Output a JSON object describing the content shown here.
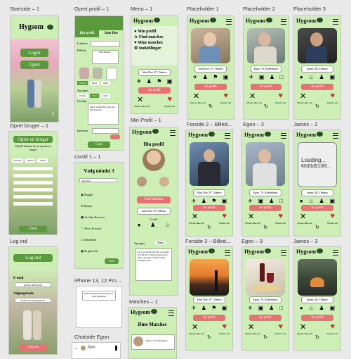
{
  "labels": {
    "startside": "Startside – 1",
    "opret_profil": "Opret profil – 1",
    "menu": "Menu – 1",
    "ph1": "Placeholder 1",
    "ph2": "Placeholder 2",
    "ph3": "Placeholder 3",
    "opret_bruger": "Opret bruger – 1",
    "min_profil": "Min Profil – 1",
    "forside2": "Forside 2 – Billed...",
    "egon2": "Egon – 2",
    "james2": "James – 2",
    "livstil": "Livstil 1 – 1",
    "log_ind": "Log ind",
    "iphone": "iPhone 13, 12 Pro ...",
    "forside3": "Forside 3 – Billed...",
    "egon3": "Egon – 3",
    "james3": "James – 3",
    "matches": "Matches – 1",
    "chatside": "Chatside Egon"
  },
  "brand": "Hygsom",
  "startside": {
    "login": "Login",
    "opret": "Opret"
  },
  "opret_profil": {
    "tab1": "Din profil",
    "tab2": "Jane Doe",
    "lokation": "Lokation",
    "billeder": "Billeder",
    "upload_hint": "Tilføj billeder +",
    "om_mig": "Om mig",
    "om_mig_text": "Indsæt beskrivelse af dig selv. Lidt interesser",
    "jeg_soger": "Jeg søger:",
    "opt1": "Kvinde",
    "opt2": "Mand",
    "opt3": "Andet",
    "interesser": "Interesser",
    "gem": "Gem"
  },
  "menu": {
    "items": [
      "Min profil",
      "Find matches",
      "Mine matches",
      "Indstillinger"
    ],
    "name": "John Doe, 87, Odense",
    "profil_btn": "Se profil",
    "skip": "Nyeste ikke om",
    "yes": "Nyeste om",
    "refresh": "Genlæs"
  },
  "cards": {
    "ph1": {
      "name": "John Doe, 87, Odense"
    },
    "ph2": {
      "name": "Egon, 76, København"
    },
    "ph3": {
      "name": "James, 82, Odense"
    },
    "forside2": {
      "name": "John Doe, 87, Odense"
    },
    "egon2": {
      "name": "Egon, 76, København"
    },
    "james2": {
      "name": "James, 82, Odense",
      "loading": "Loading...",
      "loading_id": "60d3d513f0..."
    },
    "forside3": {
      "name": "John Doe, 87, Odense"
    },
    "egon3": {
      "name": "Egon, 76, København"
    },
    "james3": {
      "name": "James, 82, Odense"
    }
  },
  "opret_bruger": {
    "title": "Opret en bruger",
    "subtitle": "Udfyld felterne for at oprette en bruger",
    "opt1": "Kvinde",
    "opt2": "Mand",
    "opt3": "Andet",
    "gem": "Gem"
  },
  "min_profil": {
    "title": "Din profil",
    "find": "Find Matches",
    "name": "Jane Doe, 67, Odense",
    "livstil": "Livstil",
    "jeg_soger": "Jeg søger:",
    "soger_value": "Mand",
    "about": "Jeg er en kvinde på 67 år, som holder af at gå ture i naturen og læse gode bøger. Jeg søger en mand at dele hverdagen med."
  },
  "livstil": {
    "title": "Vælg mindst 3",
    "search": "Søg efter...",
    "items": [
      "Hygge",
      "Rejser",
      "Se film & serier",
      "Skov & natur",
      "Dansehal",
      "Et glas vin"
    ],
    "gem": "Gem"
  },
  "log_ind": {
    "title": "Log ind",
    "email": "E-mail",
    "email_ph": "Indtast din E-mail",
    "pw": "Adgangskode",
    "pw_ph": "Indtast din adgangskode",
    "btn": "Log ind"
  },
  "iphone": {
    "text": "Indsæt beskrivelse af dig selv. Lidt interesser"
  },
  "matches": {
    "title": "Dine Matches",
    "entry": "Egon, 76, København"
  },
  "chatside": {
    "name": "Egon"
  },
  "colors": {
    "frame": "#cdeeb5",
    "accent": "#5a9a3d",
    "pink": "#e57373"
  }
}
